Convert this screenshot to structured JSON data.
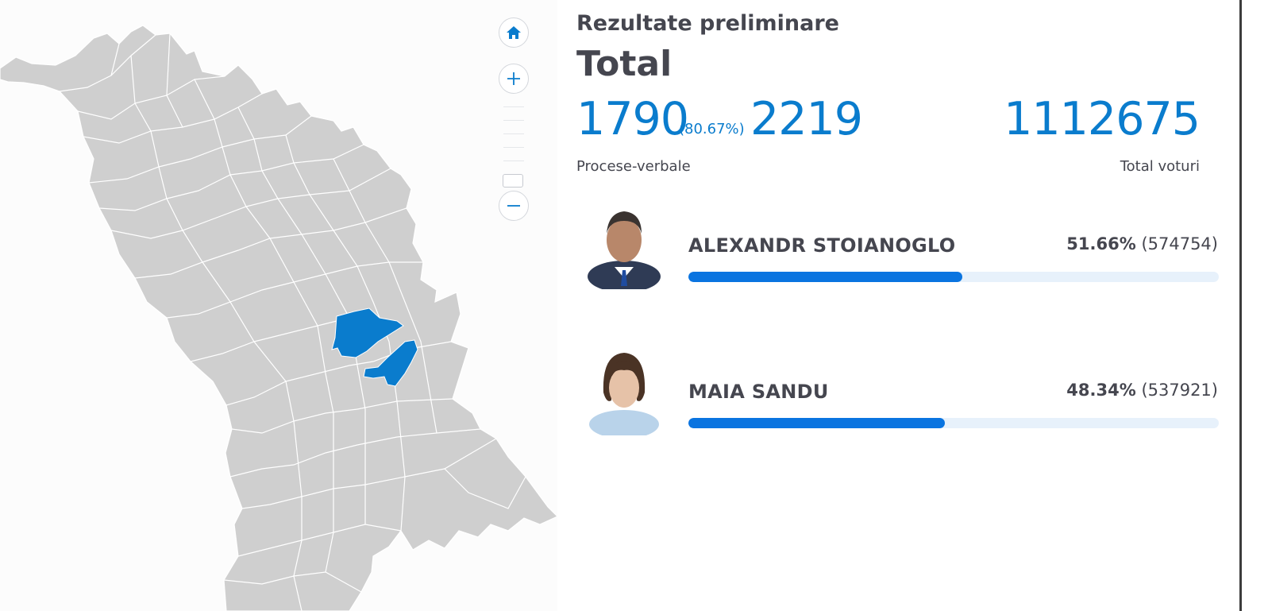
{
  "colors": {
    "accent": "#0a7ccd",
    "bar_fill": "#0a74e0",
    "bar_track": "#e7f1fb",
    "district_default": "#cfcfcf",
    "district_highlight": "#0a7ccd",
    "text": "#45464f"
  },
  "map": {
    "controls": {
      "home_icon": "home-icon",
      "zoom_in_icon": "plus-icon",
      "zoom_out_icon": "minus-icon"
    }
  },
  "results": {
    "subtitle": "Rezultate preliminare",
    "title": "Total",
    "reports_counted": "1790",
    "reports_percent": "(80.67%)",
    "reports_total": "2219",
    "reports_label": "Procese-verbale",
    "total_votes": "1112675",
    "total_votes_label": "Total voturi"
  },
  "candidates": [
    {
      "name": "ALEXANDR STOIANOGLO",
      "percent": "51.66%",
      "votes": "(574754)",
      "share": 0.5166
    },
    {
      "name": "MAIA SANDU",
      "percent": "48.34%",
      "votes": "(537921)",
      "share": 0.4834
    }
  ]
}
